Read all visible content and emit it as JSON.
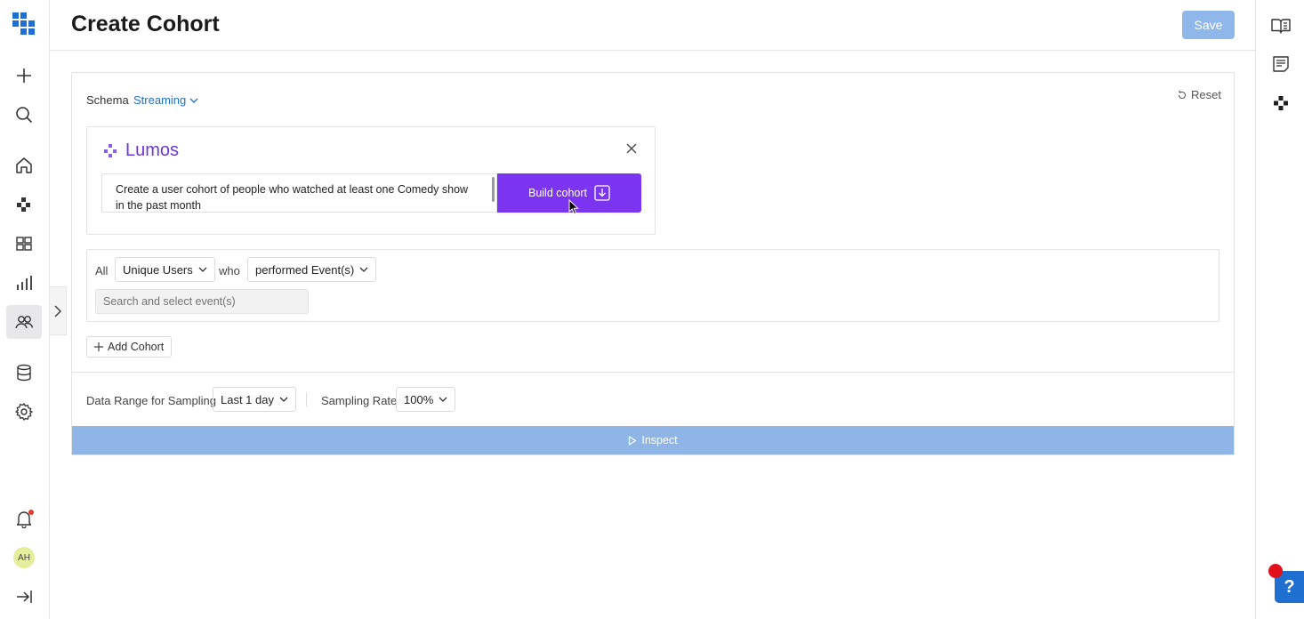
{
  "header": {
    "title": "Create Cohort",
    "save_label": "Save"
  },
  "left_nav": {
    "items": [
      {
        "name": "app-logo-icon"
      },
      {
        "name": "add-icon"
      },
      {
        "name": "search-icon"
      },
      {
        "name": "home-icon"
      },
      {
        "name": "lumos-icon"
      },
      {
        "name": "dashboards-icon"
      },
      {
        "name": "analytics-icon"
      },
      {
        "name": "cohorts-icon",
        "active": true
      },
      {
        "name": "data-icon"
      },
      {
        "name": "settings-icon"
      },
      {
        "name": "notifications-icon"
      },
      {
        "name": "collapse-nav-icon"
      }
    ],
    "avatar_initials": "AH"
  },
  "schema": {
    "label": "Schema",
    "value": "Streaming"
  },
  "reset_label": "Reset",
  "lumos": {
    "title": "Lumos",
    "prompt": "Create a user cohort of people who watched at least one Comedy show in the past month",
    "build_label": "Build cohort"
  },
  "filter": {
    "all_label": "All",
    "entity": "Unique Users",
    "who_label": "who",
    "action": "performed Event(s)",
    "event_placeholder": "Search and select event(s)"
  },
  "add_cohort_label": "Add Cohort",
  "sampling": {
    "range_label": "Data Range for Sampling",
    "range_value": "Last 1 day",
    "rate_label": "Sampling Rate",
    "rate_value": "100%"
  },
  "inspect_label": "Inspect",
  "colors": {
    "accent": "#1f6fd1",
    "lumos_purple": "#7b35f0",
    "save_disabled": "#8fb7ea"
  }
}
